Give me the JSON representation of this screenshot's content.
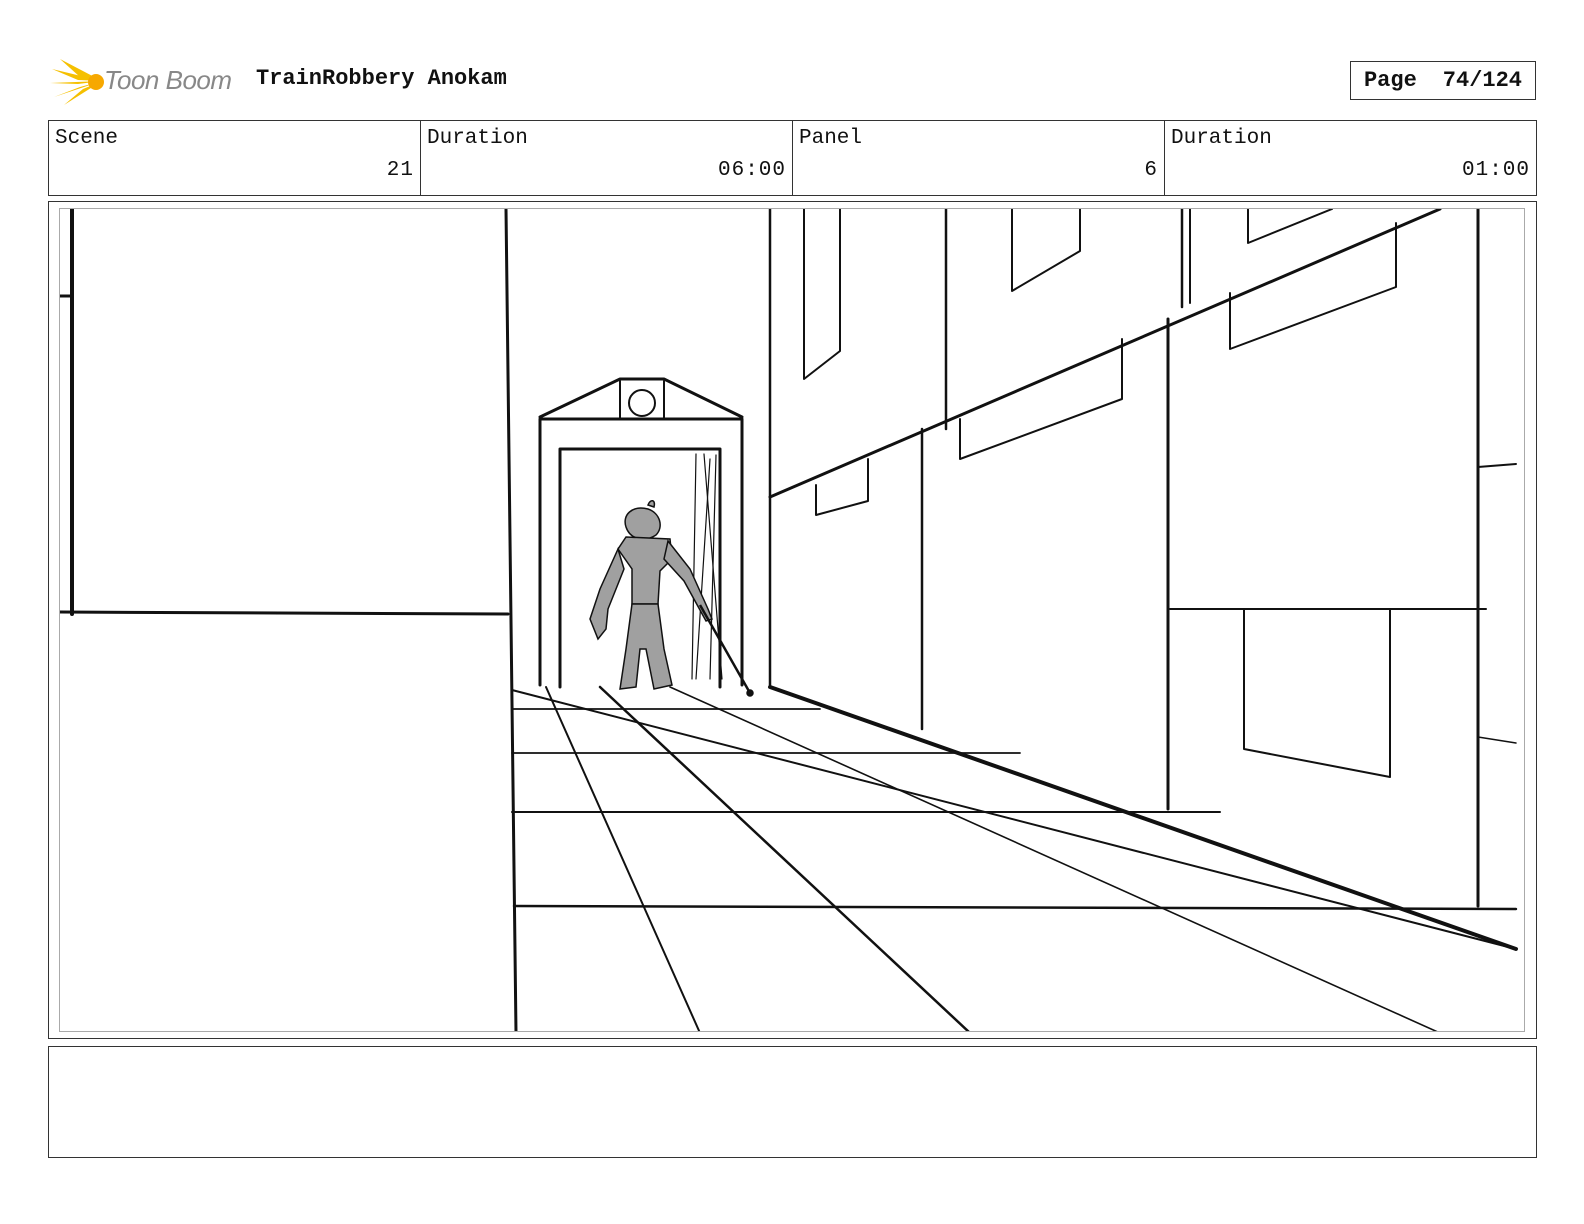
{
  "header": {
    "logo_text": "Toon Boom",
    "project_title": "TrainRobbery Anokam",
    "page_label": "Page",
    "page_number": "74/124"
  },
  "info": {
    "scene_label": "Scene",
    "scene_value": "21",
    "scene_duration_label": "Duration",
    "scene_duration_value": "06:00",
    "panel_label": "Panel",
    "panel_value": "6",
    "panel_duration_label": "Duration",
    "panel_duration_value": "01:00"
  },
  "notes": {
    "text": ""
  },
  "colors": {
    "logo_accent": "#f5c000",
    "border": "#333333",
    "sketch_figure": "#a0a0a0"
  }
}
